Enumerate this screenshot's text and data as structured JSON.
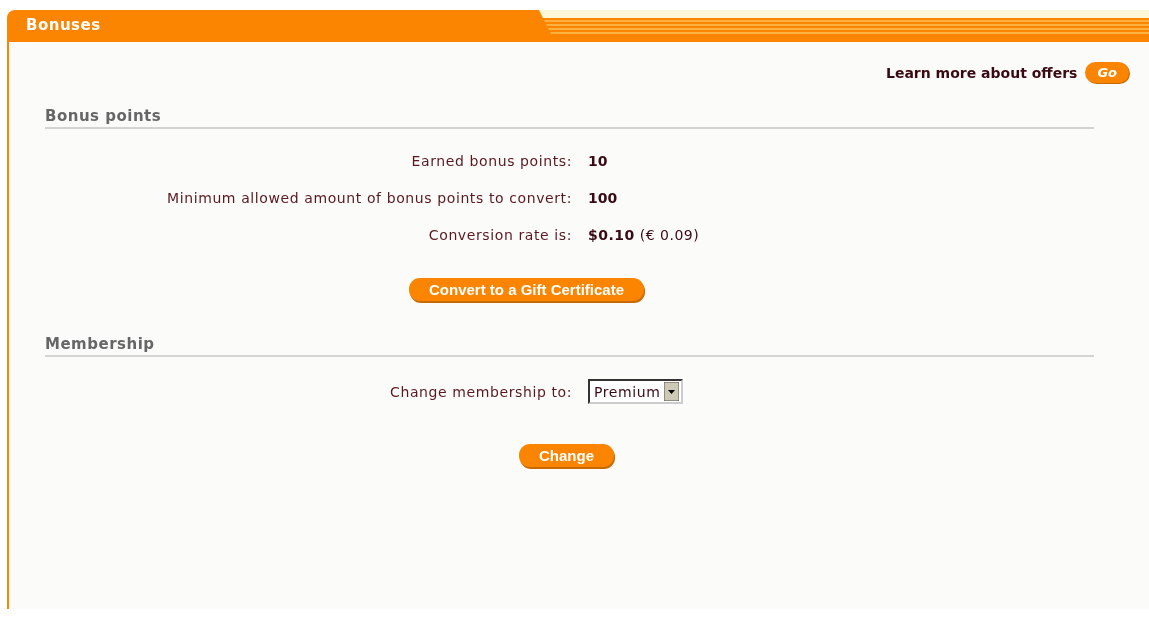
{
  "panel": {
    "title": "Bonuses"
  },
  "learn_more": {
    "text": "Learn more about offers",
    "button": "Go"
  },
  "sections": [
    {
      "heading": "Bonus points",
      "rows": [
        {
          "kind": "amount",
          "label": "Earned bonus points:",
          "value": "10"
        },
        {
          "kind": "amount",
          "label": "Minimum allowed amount of bonus points to convert:",
          "value": "100"
        },
        {
          "kind": "rate",
          "label": "Conversion rate is:",
          "value": "**$0.10** (€ 0.09)"
        }
      ],
      "button": "Convert to a Gift Certificate"
    },
    {
      "heading": "Membership",
      "rows": [
        {
          "kind": "select",
          "label": "Change membership to:",
          "value": "Premium"
        }
      ],
      "button": "Change"
    }
  ]
}
